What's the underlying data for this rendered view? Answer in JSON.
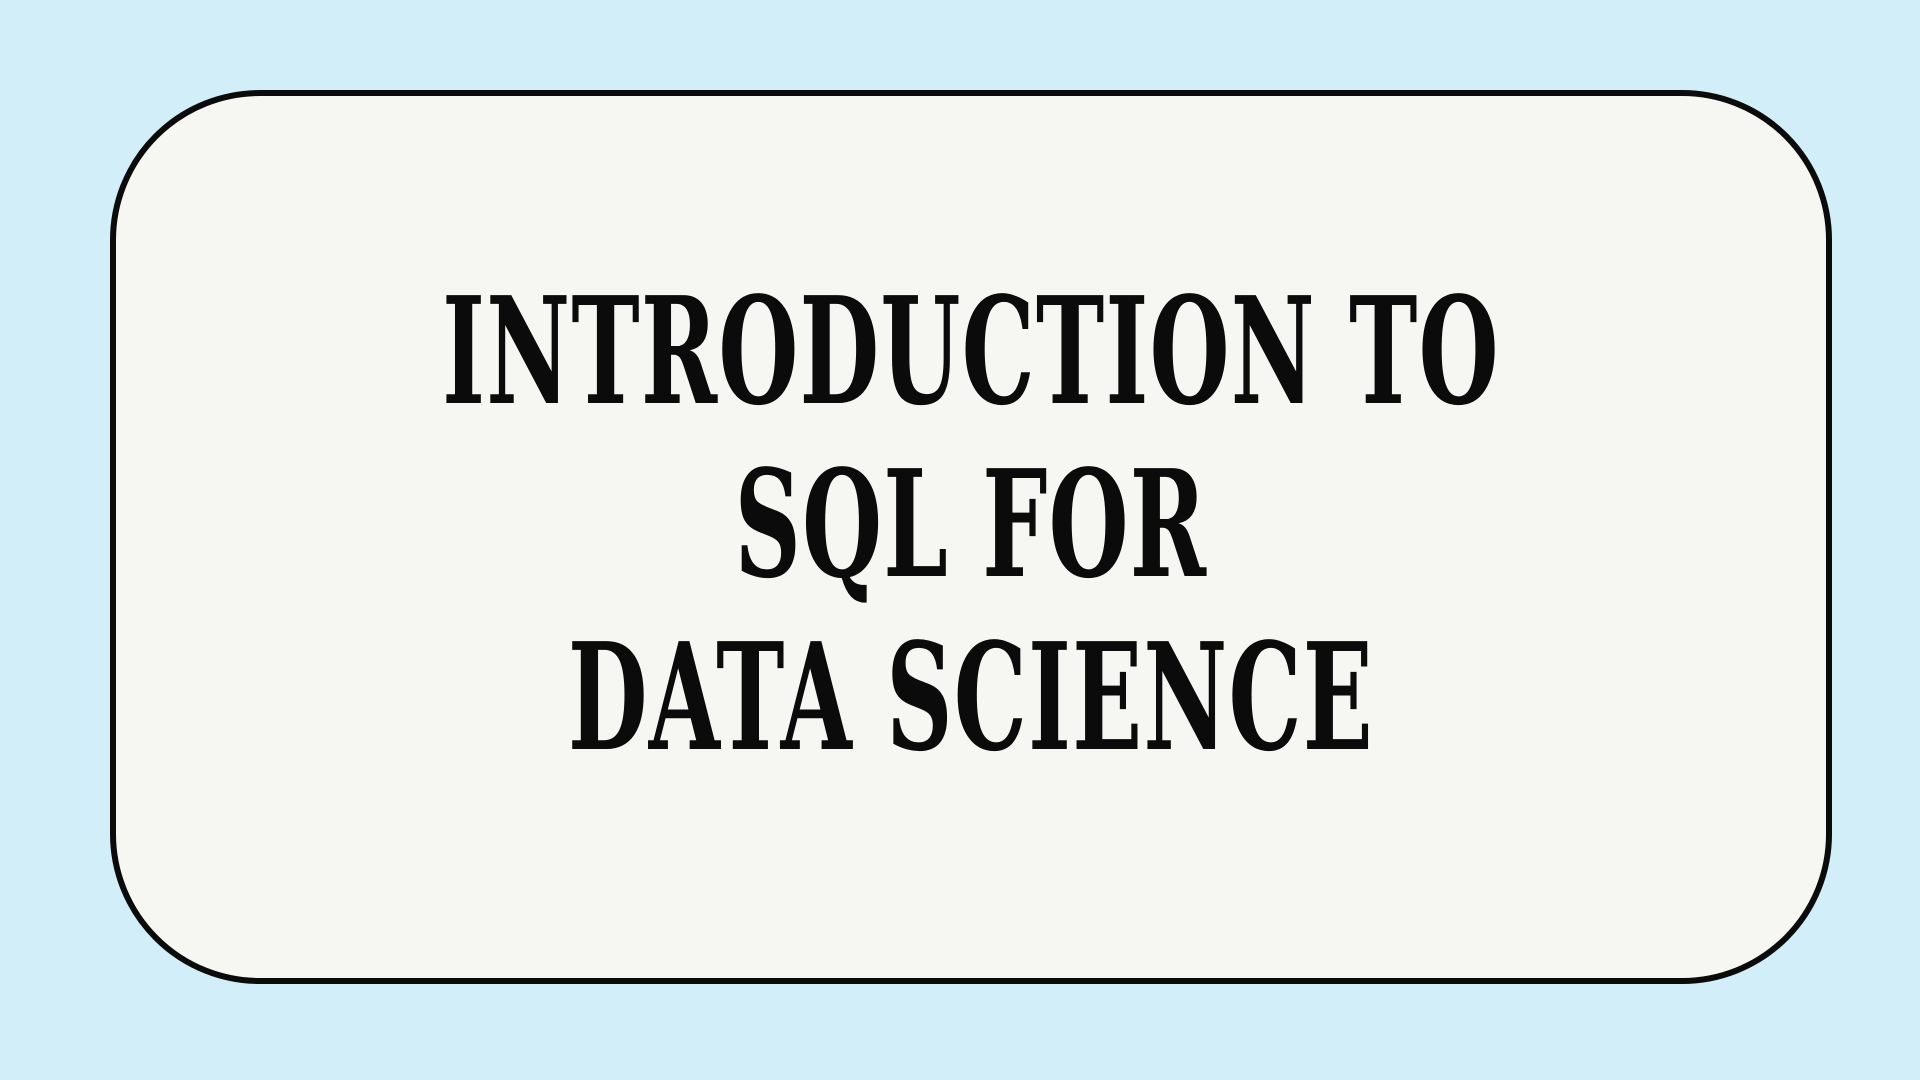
{
  "title": {
    "lines": [
      "INTRODUCTION TO",
      "SQL FOR",
      "DATA SCIENCE"
    ]
  },
  "colors": {
    "background": "#d1eef9",
    "card": "#f6f6f3",
    "ink": "#0b0b0b"
  }
}
